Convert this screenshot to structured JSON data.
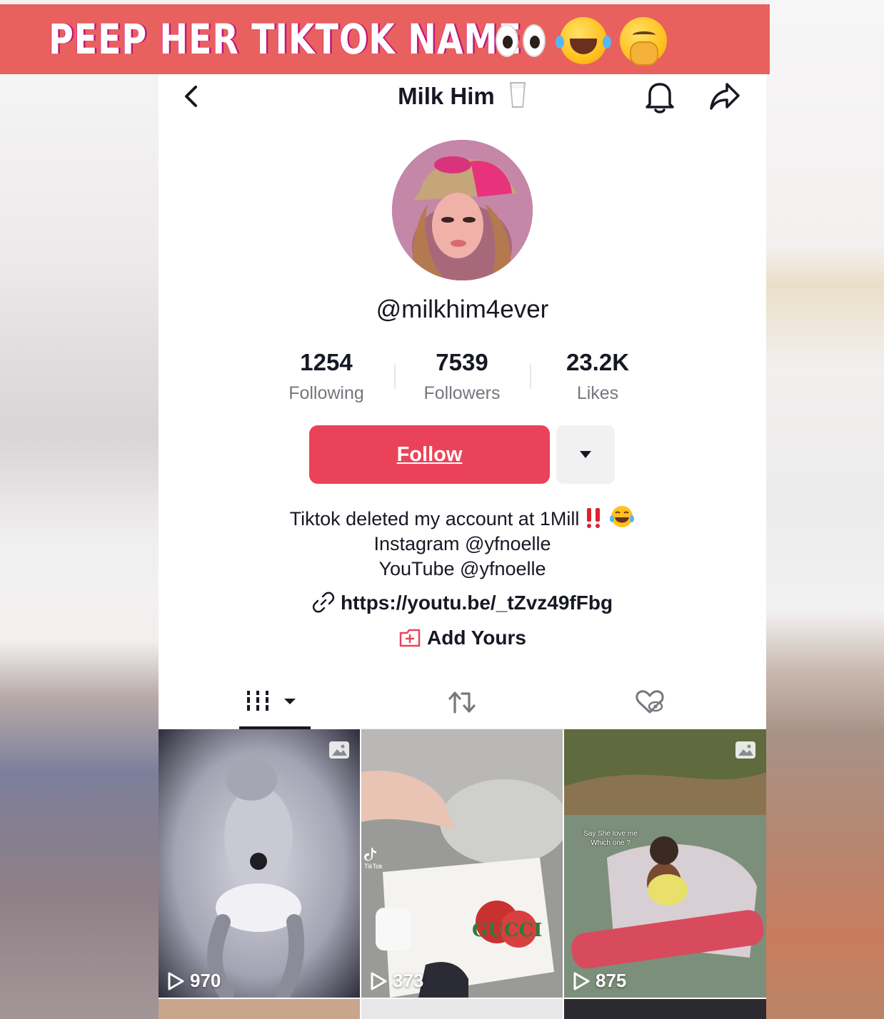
{
  "banner": {
    "text": "PEEP HER TIKTOK NAME",
    "emojis": [
      "eyes-emoji",
      "tears-of-joy-emoji",
      "hand-over-mouth-emoji"
    ]
  },
  "nav": {
    "title": "Milk Him",
    "title_emoji": "glass-of-milk-emoji",
    "icons": [
      "back-chevron-icon",
      "bell-icon",
      "share-icon"
    ]
  },
  "profile": {
    "handle": "@milkhim4ever",
    "stats": [
      {
        "value": "1254",
        "label": "Following"
      },
      {
        "value": "7539",
        "label": "Followers"
      },
      {
        "value": "23.2K",
        "label": "Likes"
      }
    ],
    "follow_label": "Follow",
    "bio": {
      "line1": "Tiktok deleted my account at 1Mill",
      "line1_emojis": [
        "double-exclamation-emoji",
        "tears-of-joy-emoji"
      ],
      "line2": "Instagram @yfnoelle",
      "line3": "YouTube @yfnoelle"
    },
    "link": "https://youtu.be/_tZvz49fFbg",
    "add_yours": "Add Yours"
  },
  "tabs": [
    {
      "name": "videos",
      "icon": "grid-columns-icon",
      "active": true
    },
    {
      "name": "reposts",
      "icon": "repost-icon",
      "active": false
    },
    {
      "name": "liked",
      "icon": "hidden-heart-icon",
      "active": false
    }
  ],
  "videos": [
    {
      "views": "970",
      "photo_badge": true
    },
    {
      "views": "373",
      "photo_badge": false,
      "watermark": "TikTok"
    },
    {
      "views": "875",
      "photo_badge": true,
      "caption_line1": "Say She love me",
      "caption_line2": "Which one ?"
    }
  ],
  "colors": {
    "banner": "#e8615e",
    "follow": "#ea4359",
    "text": "#161823",
    "muted": "#75777d"
  }
}
